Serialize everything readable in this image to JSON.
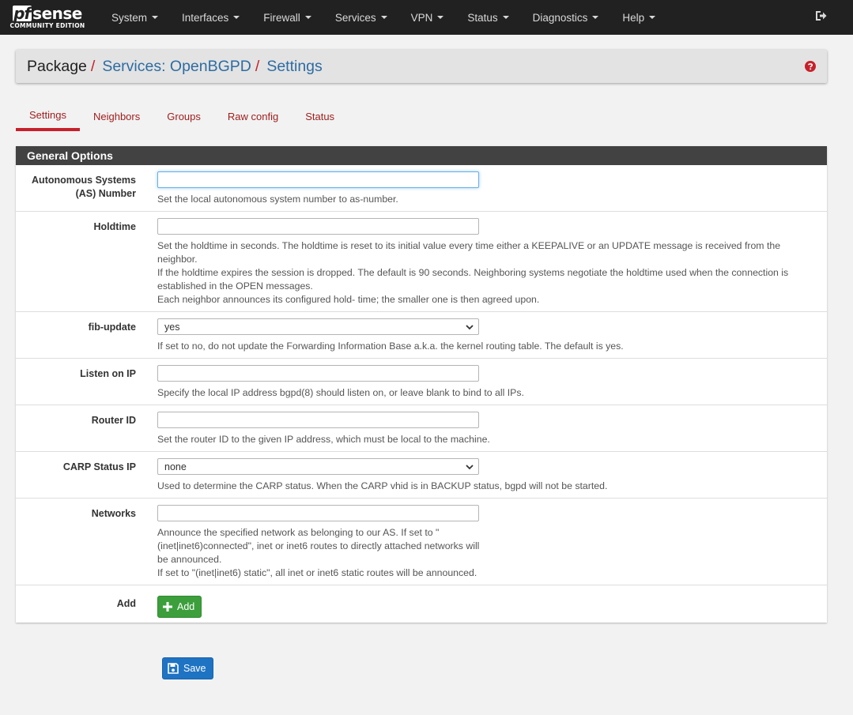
{
  "brand": {
    "pf": "pf",
    "sense": "sense",
    "edition": "COMMUNITY EDITION"
  },
  "nav": {
    "items": [
      {
        "label": "System"
      },
      {
        "label": "Interfaces"
      },
      {
        "label": "Firewall"
      },
      {
        "label": "Services"
      },
      {
        "label": "VPN"
      },
      {
        "label": "Status"
      },
      {
        "label": "Diagnostics"
      },
      {
        "label": "Help"
      }
    ],
    "logout_icon": "sign-out-icon"
  },
  "breadcrumb": {
    "root": "Package",
    "sep": "/",
    "parent": "Services: OpenBGPD",
    "current": "Settings",
    "help_icon": "question-circle-icon"
  },
  "tabs": [
    {
      "label": "Settings",
      "active": true
    },
    {
      "label": "Neighbors"
    },
    {
      "label": "Groups"
    },
    {
      "label": "Raw config"
    },
    {
      "label": "Status"
    }
  ],
  "panel": {
    "title": "General Options",
    "fields": {
      "as_number": {
        "label_line1": "Autonomous Systems",
        "label_line2": "(AS) Number",
        "value": "",
        "help": "Set the local autonomous system number to as-number."
      },
      "holdtime": {
        "label": "Holdtime",
        "value": "",
        "help1": "Set the holdtime in seconds. The holdtime is reset to its initial value every time either a KEEPALIVE or an UPDATE message is received from the neighbor.",
        "help2": "If the holdtime expires the session is dropped. The default is 90 seconds. Neighboring systems negotiate the holdtime used when the connection is established in the OPEN messages.",
        "help3": "Each neighbor announces its configured hold- time; the smaller one is then agreed upon."
      },
      "fib_update": {
        "label": "fib-update",
        "selected": "yes",
        "help": "If set to no, do not update the Forwarding Information Base a.k.a. the kernel routing table. The default is yes."
      },
      "listen_ip": {
        "label": "Listen on IP",
        "value": "",
        "help": "Specify the local IP address bgpd(8) should listen on, or leave blank to bind to all IPs."
      },
      "router_id": {
        "label": "Router ID",
        "value": "",
        "help": "Set the router ID to the given IP address, which must be local to the machine."
      },
      "carp_ip": {
        "label": "CARP Status IP",
        "selected": "none",
        "help": "Used to determine the CARP status. When the CARP vhid is in BACKUP status, bgpd will not be started."
      },
      "networks": {
        "label": "Networks",
        "value": "",
        "help1": "Announce the specified network as belonging to our AS. If set to \"(inet|inet6)connected\", inet or inet6 routes to directly attached networks will be announced.",
        "help2": "If set to \"(inet|inet6) static\", all inet or inet6 static routes will be announced."
      },
      "add": {
        "label": "Add",
        "button": "Add"
      }
    }
  },
  "save_button": "Save",
  "colors": {
    "navbar": "#212121",
    "accent_red": "#c7202a",
    "link_blue": "#2d6ca2",
    "success": "#3c9f3c",
    "primary": "#1e73c3"
  }
}
